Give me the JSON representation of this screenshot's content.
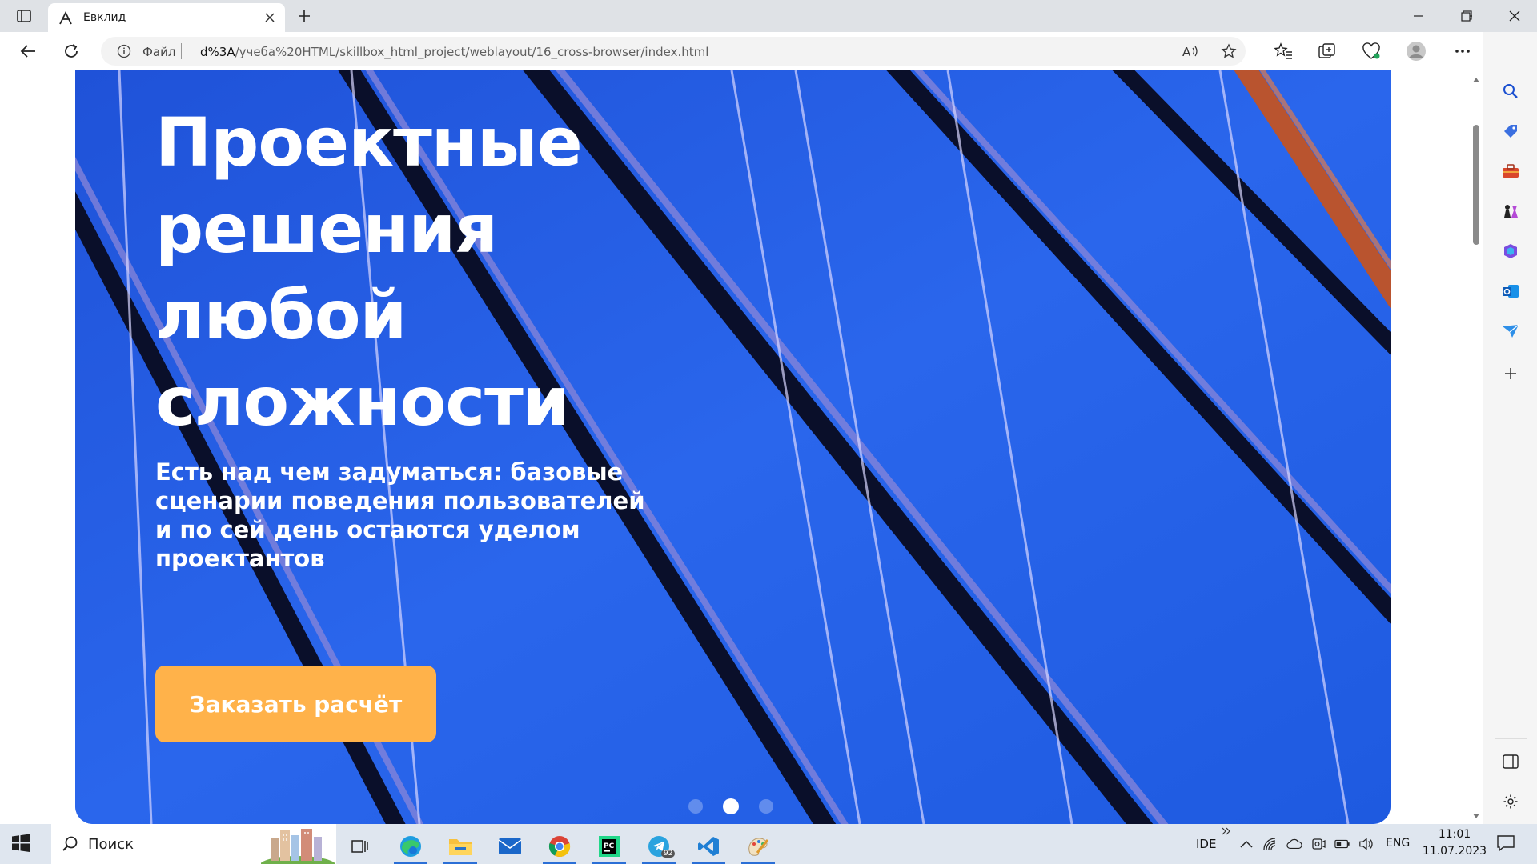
{
  "browser": {
    "tab": {
      "title": "Евклид"
    },
    "address": {
      "scheme_label": "Файл",
      "url_prefix": "d%3A",
      "url_rest": "/учеба%20HTML/skillbox_html_project/weblayout/16_cross-browser/index.html"
    }
  },
  "page": {
    "hero": {
      "title_line1": "Проектные",
      "title_line2": "решения",
      "title_line3": "любой",
      "title_line4": "сложности",
      "subtitle_line1": "Есть над чем задуматься: базовые",
      "subtitle_line2": "сценарии поведения пользователей",
      "subtitle_line3": "и по сей день остаются уделом",
      "subtitle_line4": "проектантов",
      "cta_label": "Заказать расчёт",
      "slides_count": 3,
      "active_slide": 2
    },
    "colors": {
      "hero_blue": "#1d4fd6",
      "cta": "#ffb24a"
    }
  },
  "taskbar": {
    "search_label": "Поиск",
    "telegram_badge": "92",
    "ide_label": "IDE",
    "lang": "ENG",
    "time": "11:01",
    "date": "11.07.2023"
  }
}
